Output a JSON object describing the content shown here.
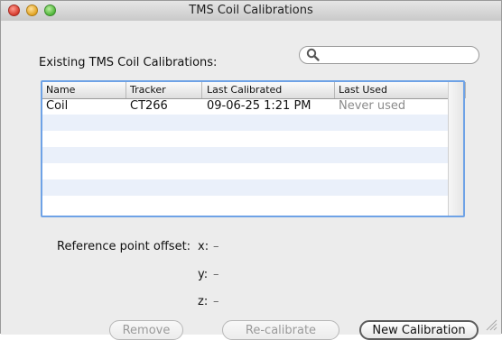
{
  "window": {
    "title": "TMS Coil Calibrations"
  },
  "search": {
    "placeholder": ""
  },
  "calibrations": {
    "section_label": "Existing TMS Coil Calibrations:",
    "columns": [
      "Name",
      "Tracker",
      "Last Calibrated",
      "Last Used"
    ],
    "rows": [
      [
        "Coil",
        "CT266",
        "09-06-25 1:21 PM",
        "Never used"
      ]
    ]
  },
  "reference_offset": {
    "label": "Reference point offset:",
    "x_label": "x:",
    "y_label": "y:",
    "z_label": "z:",
    "x_value": "–",
    "y_value": "–",
    "z_value": "–"
  },
  "buttons": {
    "remove": "Remove",
    "recalibrate": "Re-calibrate",
    "new_calibration": "New Calibration"
  },
  "icons": {
    "search": "magnifying-glass",
    "close": "red-circle",
    "minimize": "yellow-circle",
    "zoom": "green-circle"
  },
  "colors": {
    "table_focus_border": "#6ea2e6",
    "alt_row": "#eaf0fa"
  }
}
